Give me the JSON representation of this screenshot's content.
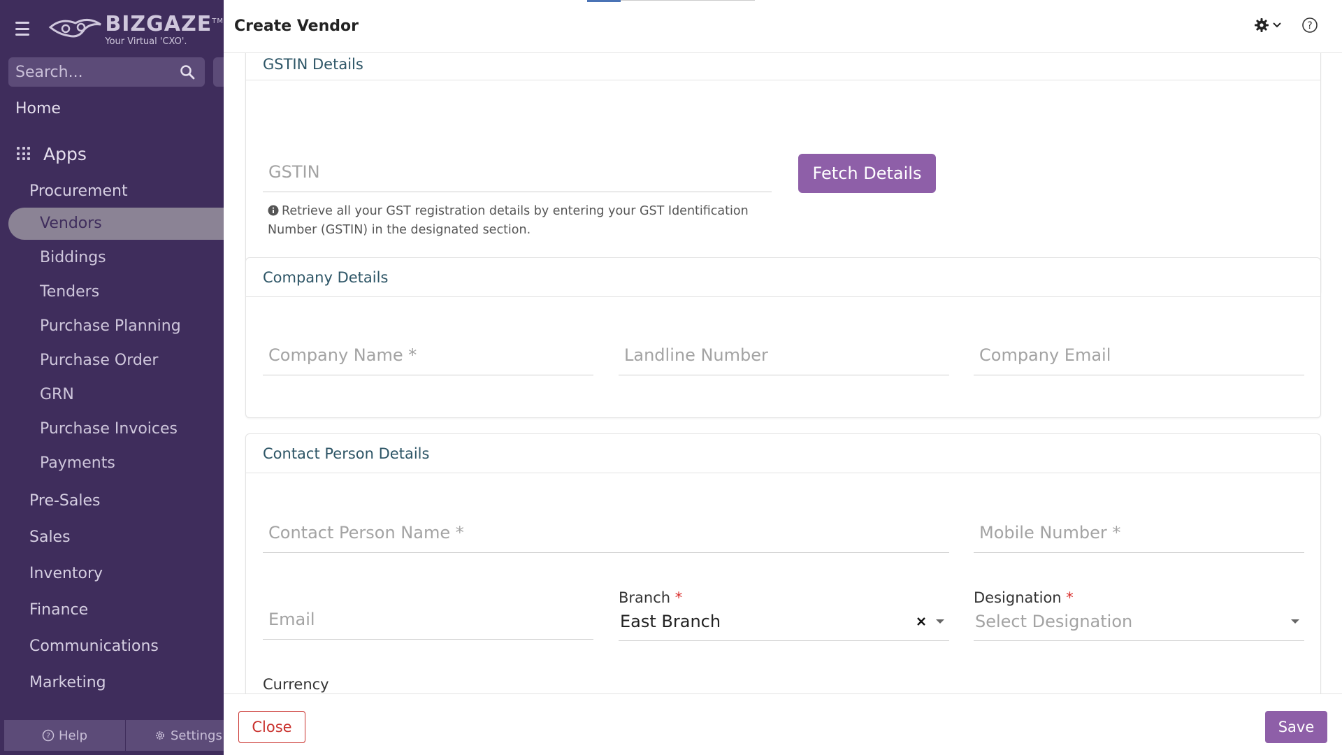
{
  "app": {
    "logo_name": "BIZGAZE",
    "logo_tm": "TM",
    "logo_tagline": "Your Virtual 'CXO'."
  },
  "sidebar": {
    "search_placeholder": "Search...",
    "home": "Home",
    "apps": "Apps",
    "section": "Procurement",
    "items": [
      {
        "label": "Vendors",
        "active": true
      },
      {
        "label": "Biddings"
      },
      {
        "label": "Tenders"
      },
      {
        "label": "Purchase Planning"
      },
      {
        "label": "Purchase Order"
      },
      {
        "label": "GRN"
      },
      {
        "label": "Purchase Invoices"
      },
      {
        "label": "Payments"
      }
    ],
    "groups": [
      "Pre-Sales",
      "Sales",
      "Inventory",
      "Finance",
      "Communications",
      "Marketing"
    ],
    "footer": {
      "help": "Help",
      "settings": "Settings"
    }
  },
  "header": {
    "title": "Create Vendor"
  },
  "gstin_section": {
    "title": "GSTIN Details",
    "gstin_placeholder": "GSTIN",
    "fetch_label": "Fetch Details",
    "hint_line1": "Retrieve all your GST registration details by entering your GST Identification",
    "hint_line2": "Number (GSTIN) in the designated section."
  },
  "company_section": {
    "title": "Company Details",
    "company_name_placeholder": "Company Name *",
    "landline_placeholder": "Landline Number",
    "company_email_placeholder": "Company Email"
  },
  "contact_section": {
    "title": "Contact Person Details",
    "contact_name_placeholder": "Contact Person Name *",
    "mobile_placeholder": "Mobile Number *",
    "email_placeholder": "Email",
    "branch_label": "Branch",
    "branch_value": "East Branch",
    "designation_label": "Designation",
    "designation_placeholder": "Select Designation",
    "currency_label": "Currency",
    "required_mark": "*"
  },
  "footer": {
    "close_label": "Close",
    "save_label": "Save"
  },
  "colors": {
    "sidebar_bg": "#3f2d5c",
    "accent": "#8e5fa8",
    "danger": "#c9302c",
    "section_title": "#2d5566"
  }
}
